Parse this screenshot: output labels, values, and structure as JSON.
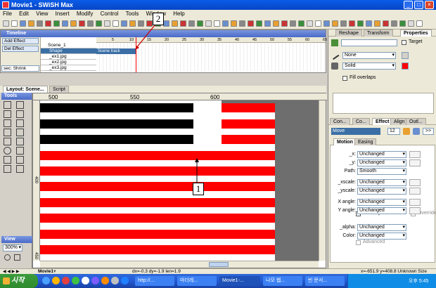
{
  "window": {
    "title": "Movie1 - SWiSH Max"
  },
  "menu": [
    "File",
    "Edit",
    "View",
    "Insert",
    "Modify",
    "Control",
    "Tools",
    "Window",
    "Help"
  ],
  "timeline": {
    "header": "Timeline",
    "add_effect": "Add Effect",
    "del_effect": "Del Effect",
    "rows": [
      {
        "name": "Scene_1"
      },
      {
        "name": "Shape",
        "effect": "Scene track"
      },
      {
        "name": "_ex1.jpg"
      },
      {
        "name": "_ex2.jpg"
      },
      {
        "name": "_ex3.jpg"
      }
    ],
    "bottom_label": "sec: Shrink",
    "ruler_marks": [
      "5",
      "10",
      "15",
      "20",
      "25",
      "30",
      "35",
      "40",
      "45",
      "50",
      "55",
      "60",
      "65"
    ]
  },
  "layout_tabs": {
    "tab1": "Layout: Scene...",
    "tab2": "Script"
  },
  "tools_label": "Tools",
  "view_label": "View",
  "zoom_value": "300%",
  "ruler": {
    "x_labels": [
      "500",
      "550",
      "600"
    ],
    "y_labels": [
      "400",
      "450"
    ]
  },
  "scene_tab": "Movie1+",
  "status": {
    "coords": "dx=-0.3 dy=-1.9 len=1.9",
    "size": "x=-651.9 y=408.8 Unknown Size"
  },
  "callouts": {
    "one": "1",
    "two": "2"
  },
  "right_panel": {
    "tabs": [
      "Reshape",
      "Transform",
      "Properties"
    ],
    "target_label": "Target",
    "line_value": "None",
    "fill_value": "Solid",
    "fill_overlaps": "Fill overlaps",
    "mid_tabs": [
      "Con...",
      "Co...",
      "Effect",
      "Align",
      "Outl..."
    ],
    "effect_name": "Move",
    "effect_frames": "12",
    "sub_tabs": [
      "Motion",
      "Easing"
    ],
    "props": [
      {
        "label": "_x:",
        "value": "Unchanged"
      },
      {
        "label": "_y:",
        "value": "Unchanged"
      },
      {
        "label": "Path:",
        "value": "Smooth"
      },
      {
        "label": "_xscale:",
        "value": "Unchanged"
      },
      {
        "label": "_yscale:",
        "value": "Unchanged"
      },
      {
        "label": "X angle:",
        "value": "Unchanged"
      },
      {
        "label": "Y angle:",
        "value": "Unchanged"
      },
      {
        "label": "_alpha:",
        "value": "Unchanged"
      },
      {
        "label": "Color:",
        "value": "Unchanged"
      }
    ],
    "follow_path": "Follow path",
    "override": "Override",
    "advanced": "Advanced",
    "pct": "%"
  },
  "taskbar": {
    "start": "시작",
    "tasks": [
      "http://...",
      "마더레...",
      "Movie1-...",
      "나모 웹...",
      "빈 문서..."
    ],
    "clock": "오후 5:45"
  },
  "colors": {
    "stripe_red": "#ff0000",
    "stage_bg": "#6e6e6e"
  }
}
